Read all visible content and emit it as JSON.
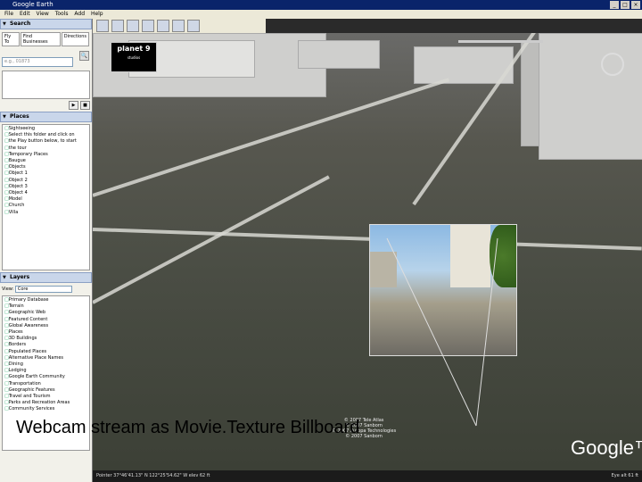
{
  "window": {
    "title": "Google Earth"
  },
  "menu": [
    "File",
    "Edit",
    "View",
    "Tools",
    "Add",
    "Help"
  ],
  "search": {
    "header": "Search",
    "tabs": [
      "Fly To",
      "Find Businesses",
      "Directions"
    ],
    "placeholder": "e.g., 01873"
  },
  "places": {
    "header": "Places",
    "items": [
      "Sightseeing",
      "Select this folder and click on",
      "the Play button below, to start",
      "the tour",
      "Temporary Places",
      "Baugue",
      "Objects",
      "Object 1",
      "Object 2",
      "Object 3",
      "Object 4",
      "Model",
      "Church",
      "Villa"
    ]
  },
  "layers": {
    "header": "Layers",
    "view_label": "View:",
    "view_value": "Core",
    "items": [
      "Primary Database",
      "Terrain",
      "Geographic Web",
      "Featured Content",
      "Global Awareness",
      "Places",
      "3D Buildings",
      "Borders",
      "Populated Places",
      "Alternative Place Names",
      "Dining",
      "Lodging",
      "Google Earth Community",
      "Transportation",
      "Geographic Features",
      "Travel and Tourism",
      "Parks and Recreation Areas",
      "Community Services"
    ]
  },
  "viewer": {
    "logo_main": "planet 9",
    "logo_sub": "studios",
    "caption": "Webcam stream as Movie.Texture Billboard",
    "google_logo": "Google™",
    "copyright": [
      "© 2007 Tele Atlas",
      "© 2007 Sanborn",
      "© 2007 Europa Technologies",
      "© 2007 Sanborn"
    ],
    "status_left": "Pointer 37°46'41.13\" N 122°25'54.62\" W  elev 62 ft",
    "status_right": "Eye alt 61 ft"
  },
  "colors": {
    "titlebar": "#0a246a",
    "panel_header": "#c9d6ea"
  }
}
